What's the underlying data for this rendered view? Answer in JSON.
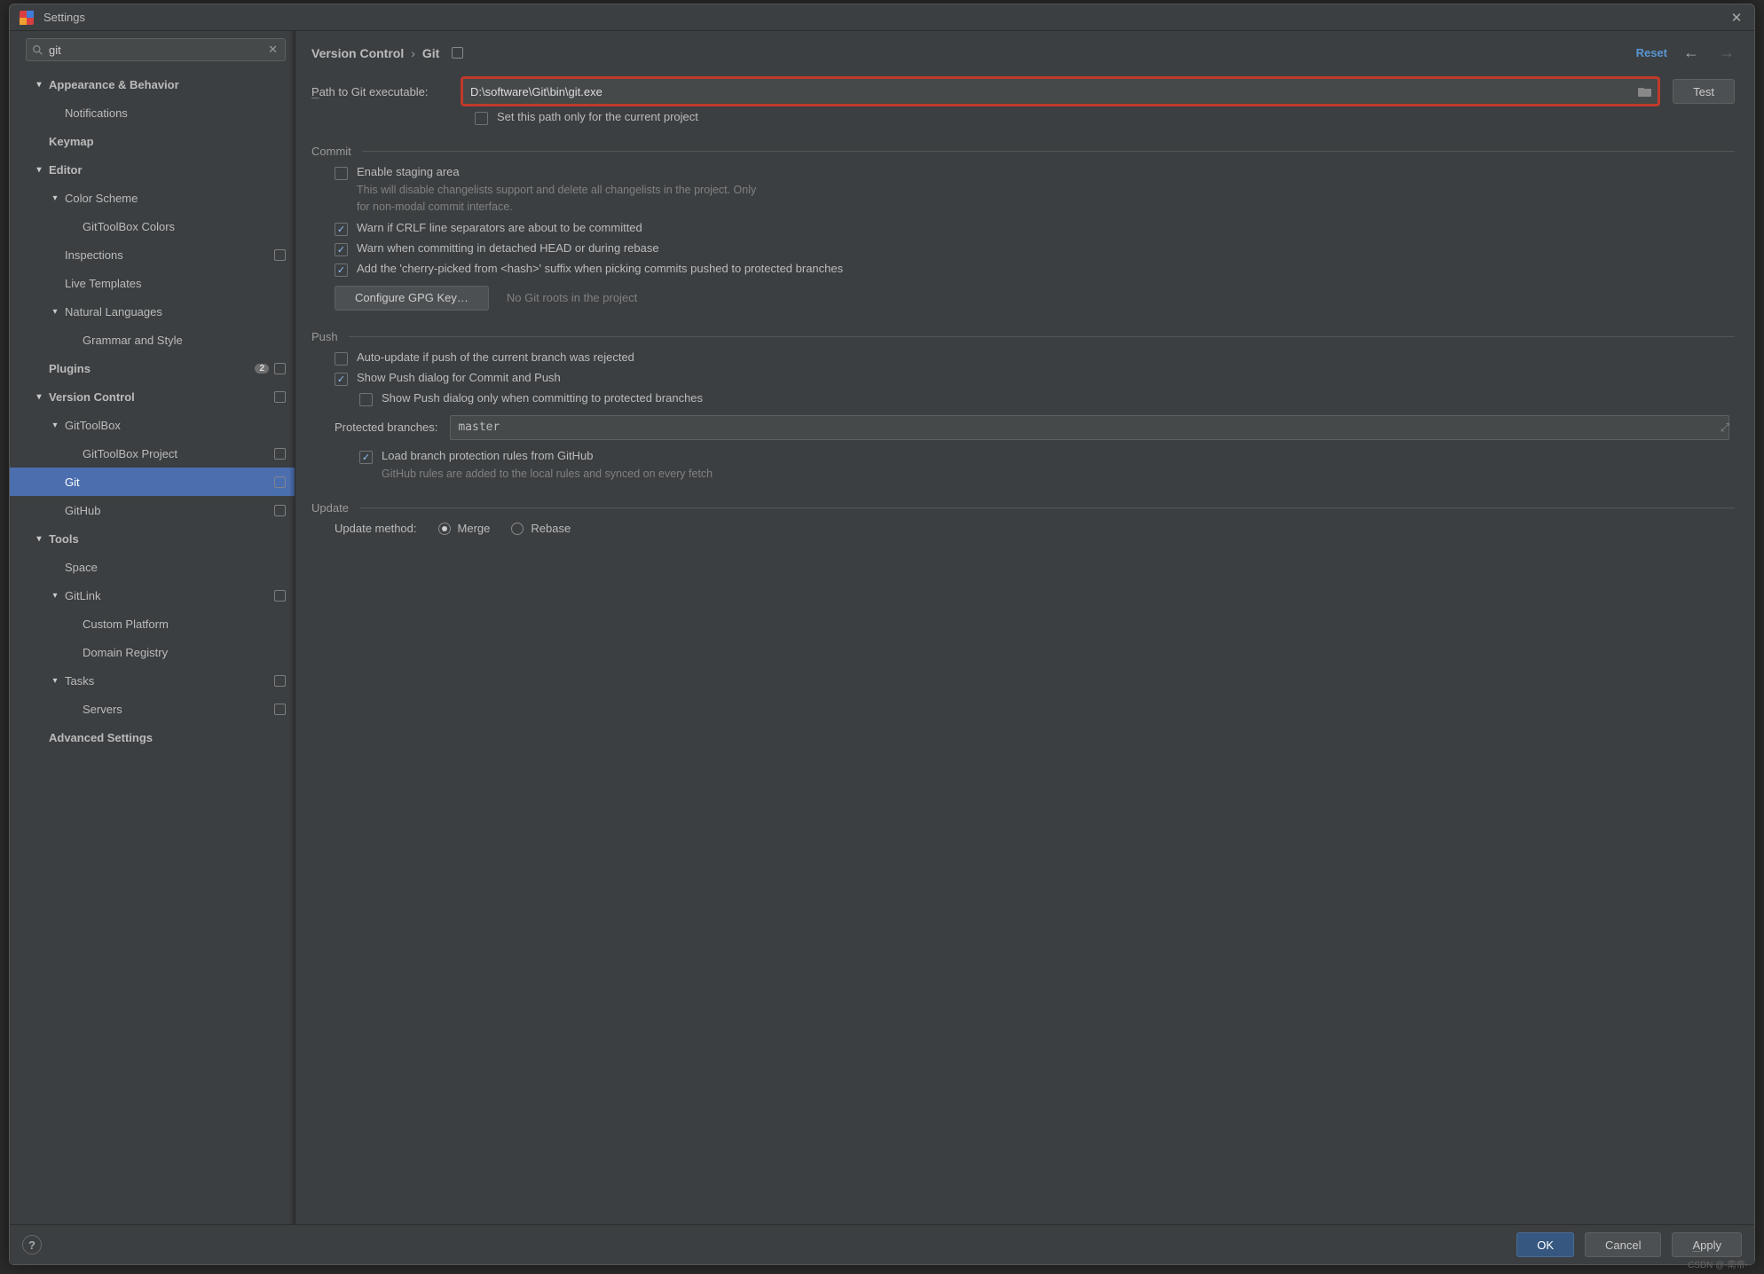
{
  "window": {
    "title": "Settings"
  },
  "search": {
    "value": "git"
  },
  "tree": [
    {
      "level": 0,
      "expand": "down",
      "label": "Appearance & Behavior",
      "bold": true
    },
    {
      "level": 1,
      "label": "Notifications"
    },
    {
      "level": 0,
      "label": "Keymap",
      "bold": true
    },
    {
      "level": 0,
      "expand": "down",
      "label": "Editor",
      "bold": true
    },
    {
      "level": 1,
      "expand": "down",
      "label": "Color Scheme"
    },
    {
      "level": 2,
      "label": "GitToolBox Colors"
    },
    {
      "level": 1,
      "label": "Inspections",
      "cfg": true
    },
    {
      "level": 1,
      "label": "Live Templates"
    },
    {
      "level": 1,
      "expand": "down",
      "label": "Natural Languages"
    },
    {
      "level": 2,
      "label": "Grammar and Style"
    },
    {
      "level": 0,
      "label": "Plugins",
      "bold": true,
      "badge": "2",
      "cfg": true
    },
    {
      "level": 0,
      "expand": "down",
      "label": "Version Control",
      "bold": true,
      "cfg": true
    },
    {
      "level": 1,
      "expand": "down",
      "label": "GitToolBox"
    },
    {
      "level": 2,
      "label": "GitToolBox Project",
      "cfg": true
    },
    {
      "level": 1,
      "label": "Git",
      "cfg": true,
      "selected": true
    },
    {
      "level": 1,
      "label": "GitHub",
      "cfg": true
    },
    {
      "level": 0,
      "expand": "down",
      "label": "Tools",
      "bold": true
    },
    {
      "level": 1,
      "label": "Space"
    },
    {
      "level": 1,
      "expand": "down",
      "label": "GitLink",
      "cfg": true
    },
    {
      "level": 2,
      "label": "Custom Platform"
    },
    {
      "level": 2,
      "label": "Domain Registry"
    },
    {
      "level": 1,
      "expand": "down",
      "label": "Tasks",
      "cfg": true
    },
    {
      "level": 2,
      "label": "Servers",
      "cfg": true
    },
    {
      "level": 0,
      "label": "Advanced Settings",
      "bold": true
    }
  ],
  "breadcrumb": {
    "root": "Version Control",
    "leaf": "Git"
  },
  "header": {
    "reset": "Reset"
  },
  "git": {
    "path_label": "Path to Git executable:",
    "path_value": "D:\\software\\Git\\bin\\git.exe",
    "test_label": "Test",
    "only_current": "Set this path only for the current project"
  },
  "commit": {
    "title": "Commit",
    "enable_staging": "Enable staging area",
    "enable_staging_hint": "This will disable changelists support and delete all changelists in the project. Only for non-modal commit interface.",
    "warn_crlf": "Warn if CRLF line separators are about to be committed",
    "warn_detached": "Warn when committing in detached HEAD or during rebase",
    "cherry_suffix": "Add the 'cherry-picked from <hash>' suffix when picking commits pushed to protected branches",
    "configure_gpg": "Configure GPG Key…",
    "no_roots": "No Git roots in the project"
  },
  "push": {
    "title": "Push",
    "auto_update": "Auto-update if push of the current branch was rejected",
    "show_dialog": "Show Push dialog for Commit and Push",
    "show_dialog_protected": "Show Push dialog only when committing to protected branches",
    "protected_label": "Protected branches:",
    "protected_value": "master",
    "load_rules": "Load branch protection rules from GitHub",
    "load_rules_hint": "GitHub rules are added to the local rules and synced on every fetch"
  },
  "update": {
    "title": "Update",
    "method_label": "Update method:",
    "merge": "Merge",
    "rebase": "Rebase"
  },
  "footer": {
    "ok": "OK",
    "cancel": "Cancel",
    "apply": "Apply"
  },
  "watermark": "CSDN @-南帝-"
}
